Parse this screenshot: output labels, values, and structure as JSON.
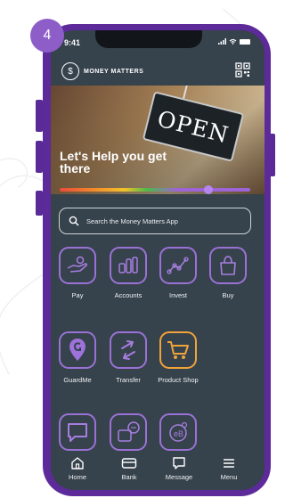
{
  "step_number": "4",
  "status_bar": {
    "time": "9:41"
  },
  "header": {
    "brand": "MONEY MATTERS"
  },
  "banner": {
    "title": "Let's Help you get there",
    "sign_text": "OPEN"
  },
  "search": {
    "placeholder": "Search the Money Matters App"
  },
  "tiles": [
    {
      "label": "Pay",
      "icon": "pay-hand-icon"
    },
    {
      "label": "Accounts",
      "icon": "accounts-icon"
    },
    {
      "label": "Invest",
      "icon": "invest-chart-icon"
    },
    {
      "label": "Buy",
      "icon": "shopping-bag-icon"
    },
    {
      "label": "GuardMe",
      "icon": "guard-pin-icon"
    },
    {
      "label": "Transfer",
      "icon": "transfer-arrows-icon"
    },
    {
      "label": "Product Shop",
      "icon": "shopping-cart-icon"
    },
    {
      "label": "",
      "icon": "chat-icon"
    },
    {
      "label": "",
      "icon": "message-support-icon"
    },
    {
      "label": "",
      "icon": "e-balance-icon"
    }
  ],
  "bottom_nav": [
    {
      "label": "Home",
      "icon": "home-icon"
    },
    {
      "label": "Bank",
      "icon": "bank-card-icon"
    },
    {
      "label": "Message",
      "icon": "message-icon"
    },
    {
      "label": "Menu",
      "icon": "menu-icon"
    }
  ],
  "colors": {
    "phone_frame": "#5d2a9a",
    "screen_bg": "#36424c",
    "tile_border": "#9a72d6",
    "shop_border": "#f0a33a",
    "step_badge": "#8e5ec8"
  }
}
